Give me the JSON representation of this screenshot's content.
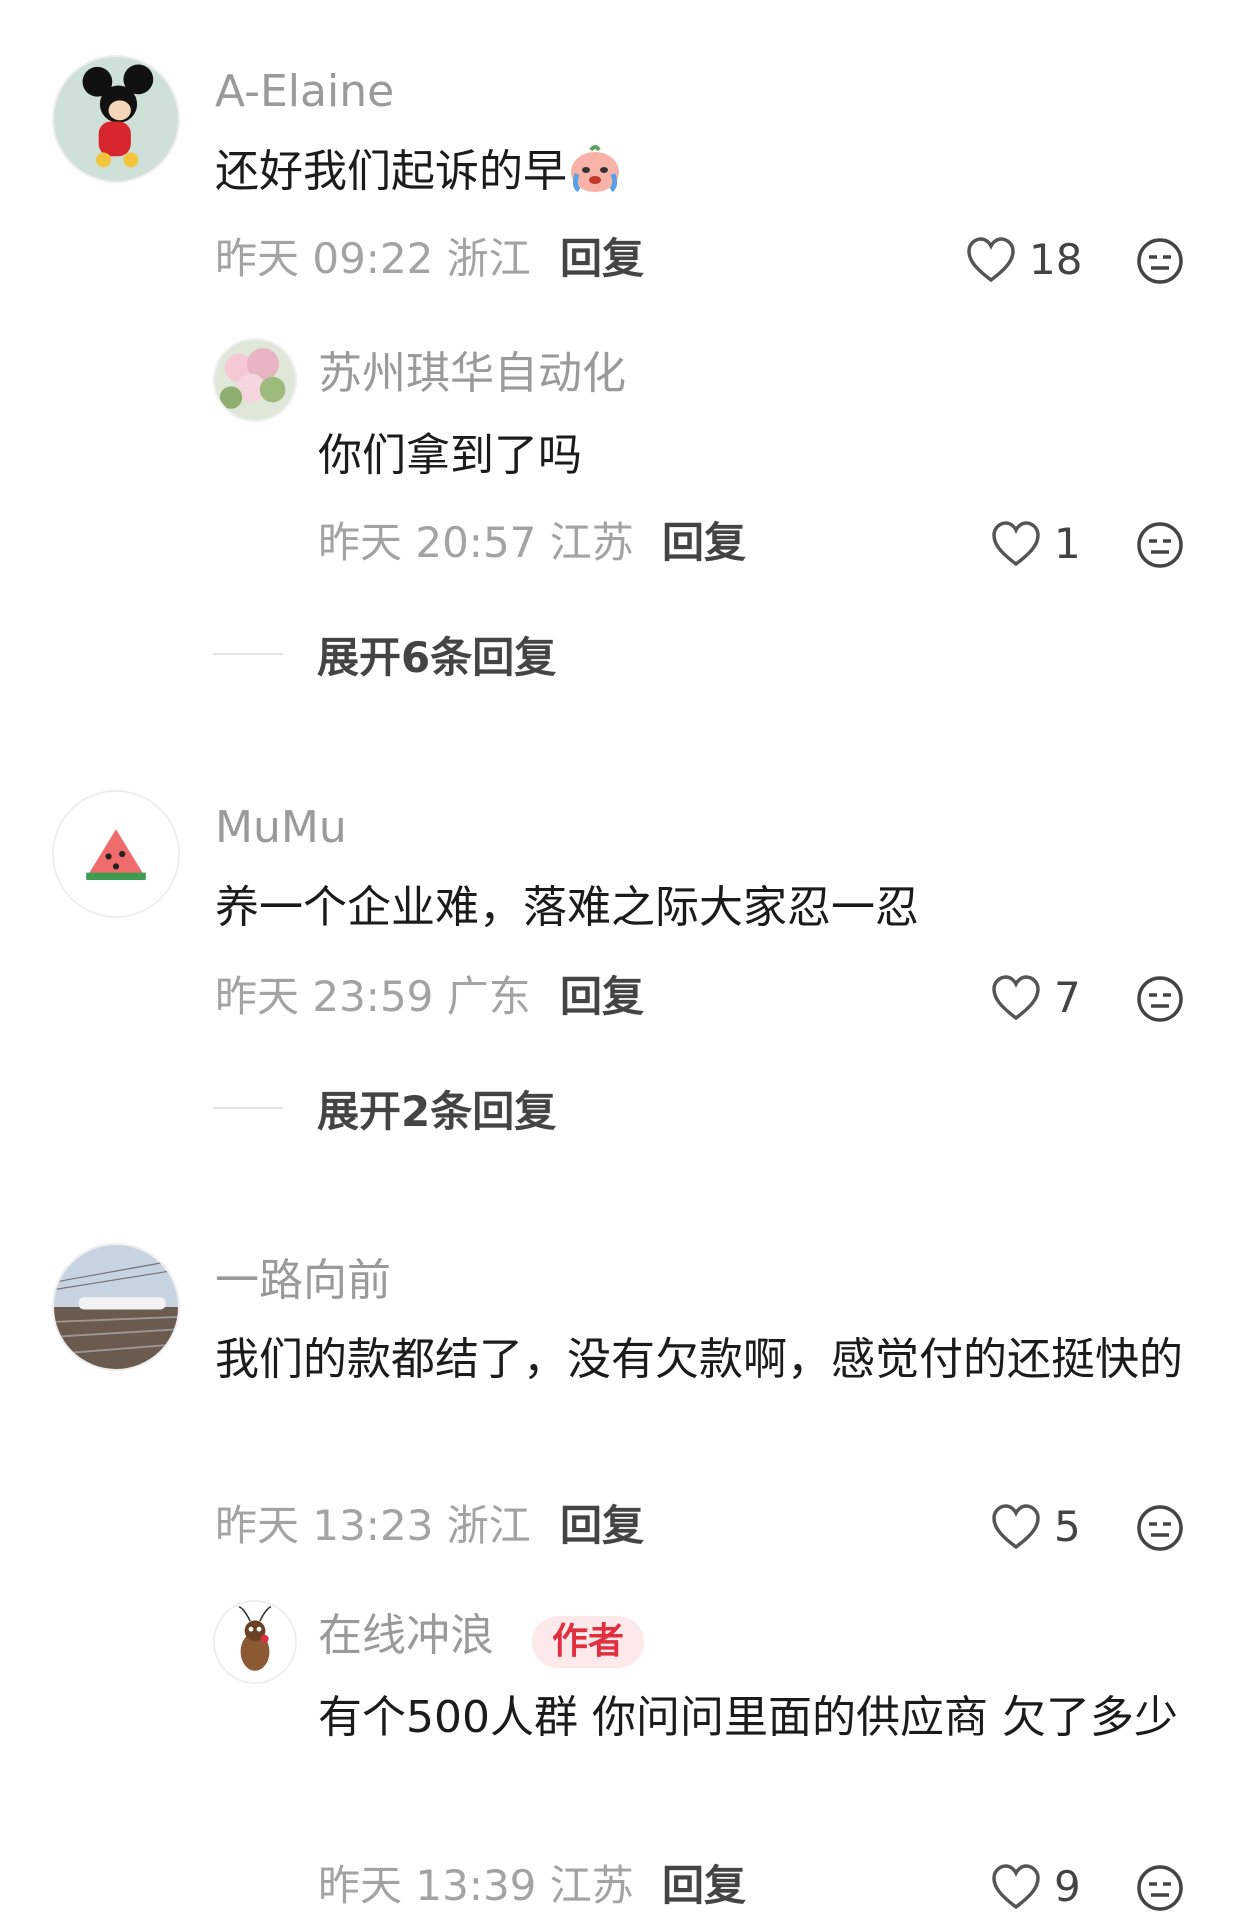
{
  "comments": [
    {
      "user": "A-Elaine",
      "text": "还好我们起诉的早",
      "emoji": "crying-peach-emoji",
      "time": "昨天 09:22 浙江",
      "reply_label": "回复",
      "likes": "18",
      "sub": {
        "user": "苏州琪华自动化",
        "text": "你们拿到了吗",
        "time": "昨天 20:57 江苏",
        "reply_label": "回复",
        "likes": "1"
      },
      "expand_label": "展开6条回复"
    },
    {
      "user": "MuMu",
      "text": "养一个企业难，落难之际大家忍一忍",
      "time": "昨天 23:59 广东",
      "reply_label": "回复",
      "likes": "7",
      "expand_label": "展开2条回复"
    },
    {
      "user": "一路向前",
      "text": "我们的款都结了，没有欠款啊，感觉付的还挺快的",
      "time": "昨天 13:23 浙江",
      "reply_label": "回复",
      "likes": "5",
      "sub": {
        "user": "在线冲浪",
        "badge": "作者",
        "text": "有个500人群 你问问里面的供应商 欠了多少",
        "time": "昨天 13:39 江苏",
        "reply_label": "回复",
        "likes": "9"
      }
    }
  ],
  "icons": {
    "like": "heart-outline-icon",
    "more": "neutral-face-icon"
  },
  "colors": {
    "name": "#9a9a9a",
    "meta": "#a3a3a3",
    "author_badge_bg": "#fde9ea",
    "author_badge_text": "#e0303f"
  }
}
